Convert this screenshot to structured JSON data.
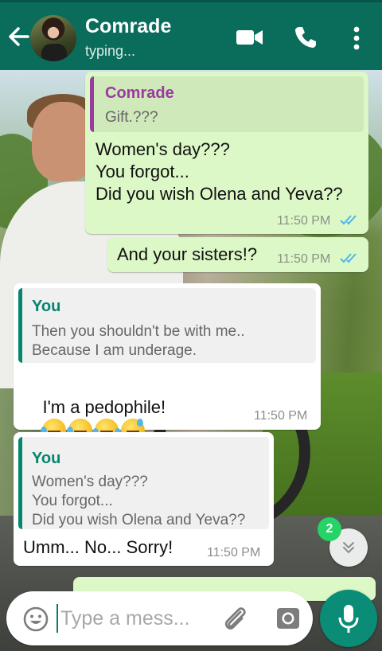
{
  "header": {
    "contact_name": "Comrade",
    "status": "typing..."
  },
  "messages": [
    {
      "direction": "outgoing",
      "quote": {
        "author": "Comrade",
        "text": "Gift.???"
      },
      "text": "Women's day???\nYou forgot...\nDid you wish Olena and Yeva??",
      "time": "11:50 PM",
      "read": true
    },
    {
      "direction": "outgoing",
      "text": "And your sisters!?",
      "time": "11:50 PM",
      "read": true
    },
    {
      "direction": "incoming",
      "quote": {
        "author": "You",
        "text": "Then you shouldn't be with me..\nBecause I am underage."
      },
      "text": "I'm a pedophile!",
      "emojis": [
        "rolling-on-floor-laughing-emoji",
        "rolling-on-floor-laughing-emoji",
        "tears-of-joy-emoji",
        "grinning-sweat-emoji"
      ],
      "time": "11:50 PM"
    },
    {
      "direction": "incoming",
      "quote": {
        "author": "You",
        "text": "Women's day???\nYou forgot...\nDid you wish Olena and Yeva??"
      },
      "text": "Umm... No... Sorry!",
      "time": "11:50 PM"
    }
  ],
  "scroll": {
    "unread_count": "2"
  },
  "composer": {
    "placeholder": "Type a mess..."
  },
  "colors": {
    "header": "#0a6c5b",
    "outgoing_bubble": "#dcf8c6",
    "incoming_bubble": "#ffffff",
    "read_ticks": "#4fb6ec",
    "quote_author_out": "#9a3ba0",
    "quote_author_in": "#06856f",
    "unread_badge": "#25d366",
    "mic_button": "#0a8c77"
  },
  "icons": [
    "back-arrow-icon",
    "video-call-icon",
    "phone-icon",
    "more-vert-icon",
    "double-check-icon",
    "chevron-double-down-icon",
    "emoji-icon",
    "attach-icon",
    "camera-icon",
    "mic-icon"
  ]
}
